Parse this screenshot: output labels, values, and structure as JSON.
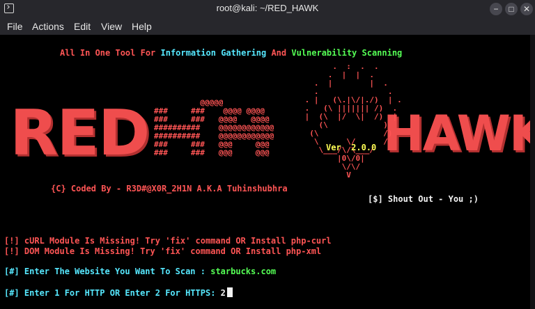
{
  "window": {
    "title": "root@kali: ~/RED_HAWK",
    "buttons": {
      "minimize": "−",
      "maximize": "□",
      "close": "✕"
    }
  },
  "menu": [
    "File",
    "Actions",
    "Edit",
    "View",
    "Help"
  ],
  "banner": {
    "tagline": {
      "p1": "All In One Tool For ",
      "p2": "Information Gathering",
      "p3": " And ",
      "p4": "Vulnerability Scanning"
    },
    "logo_text_red": "RED",
    "logo_text_hawk": "HAWK",
    "version": "Ver  2.0.0",
    "credit": "{C} Coded By - R3D#@X0R_2H1N A.K.A Tuhinshubhra",
    "shoutout": "[$] Shout Out - You ;)"
  },
  "ascii": {
    "hash_art": "          @@@@@\n###     ###    @@@@ @@@@\n###     ###   @@@@   @@@@\n##########    @@@@@@@@@@@@\n##########    @@@@@@@@@@@@\n###     ###   @@@     @@@\n###     ###   @@@     @@@",
    "hawk_art": "       .  :  .  .\n      .  |  |  .\n   .  |        |  .\n   .               .\n . |   (\\.|\\/|./)  | .\n .   (\\ ||||||| /)  .\n |  (\\  |/  \\|  /)  |\n    (\\            )\n  (\\              /)\n   \\      \\/      /\n    \\___/\\/\\___/\n        |0\\/0|\n         \\/\\/\n          V"
  },
  "output": {
    "curl_missing": "[!] cURL Module Is Missing! Try 'fix' command OR Install php-curl",
    "dom_missing": "[!] DOM Module Is Missing! Try 'fix' command OR Install php-xml",
    "scan_prompt": "[#] Enter The Website You Want To Scan : ",
    "scan_value": "starbucks.com",
    "protocol_prompt": "[#] Enter 1 For HTTP OR Enter 2 For HTTPS: ",
    "protocol_value": "2"
  },
  "colors": {
    "red": "#ff5555",
    "cyan": "#56e8ff",
    "green": "#55ff55",
    "yellow": "#ffff55",
    "background": "#000000",
    "chrome": "#27272c"
  }
}
